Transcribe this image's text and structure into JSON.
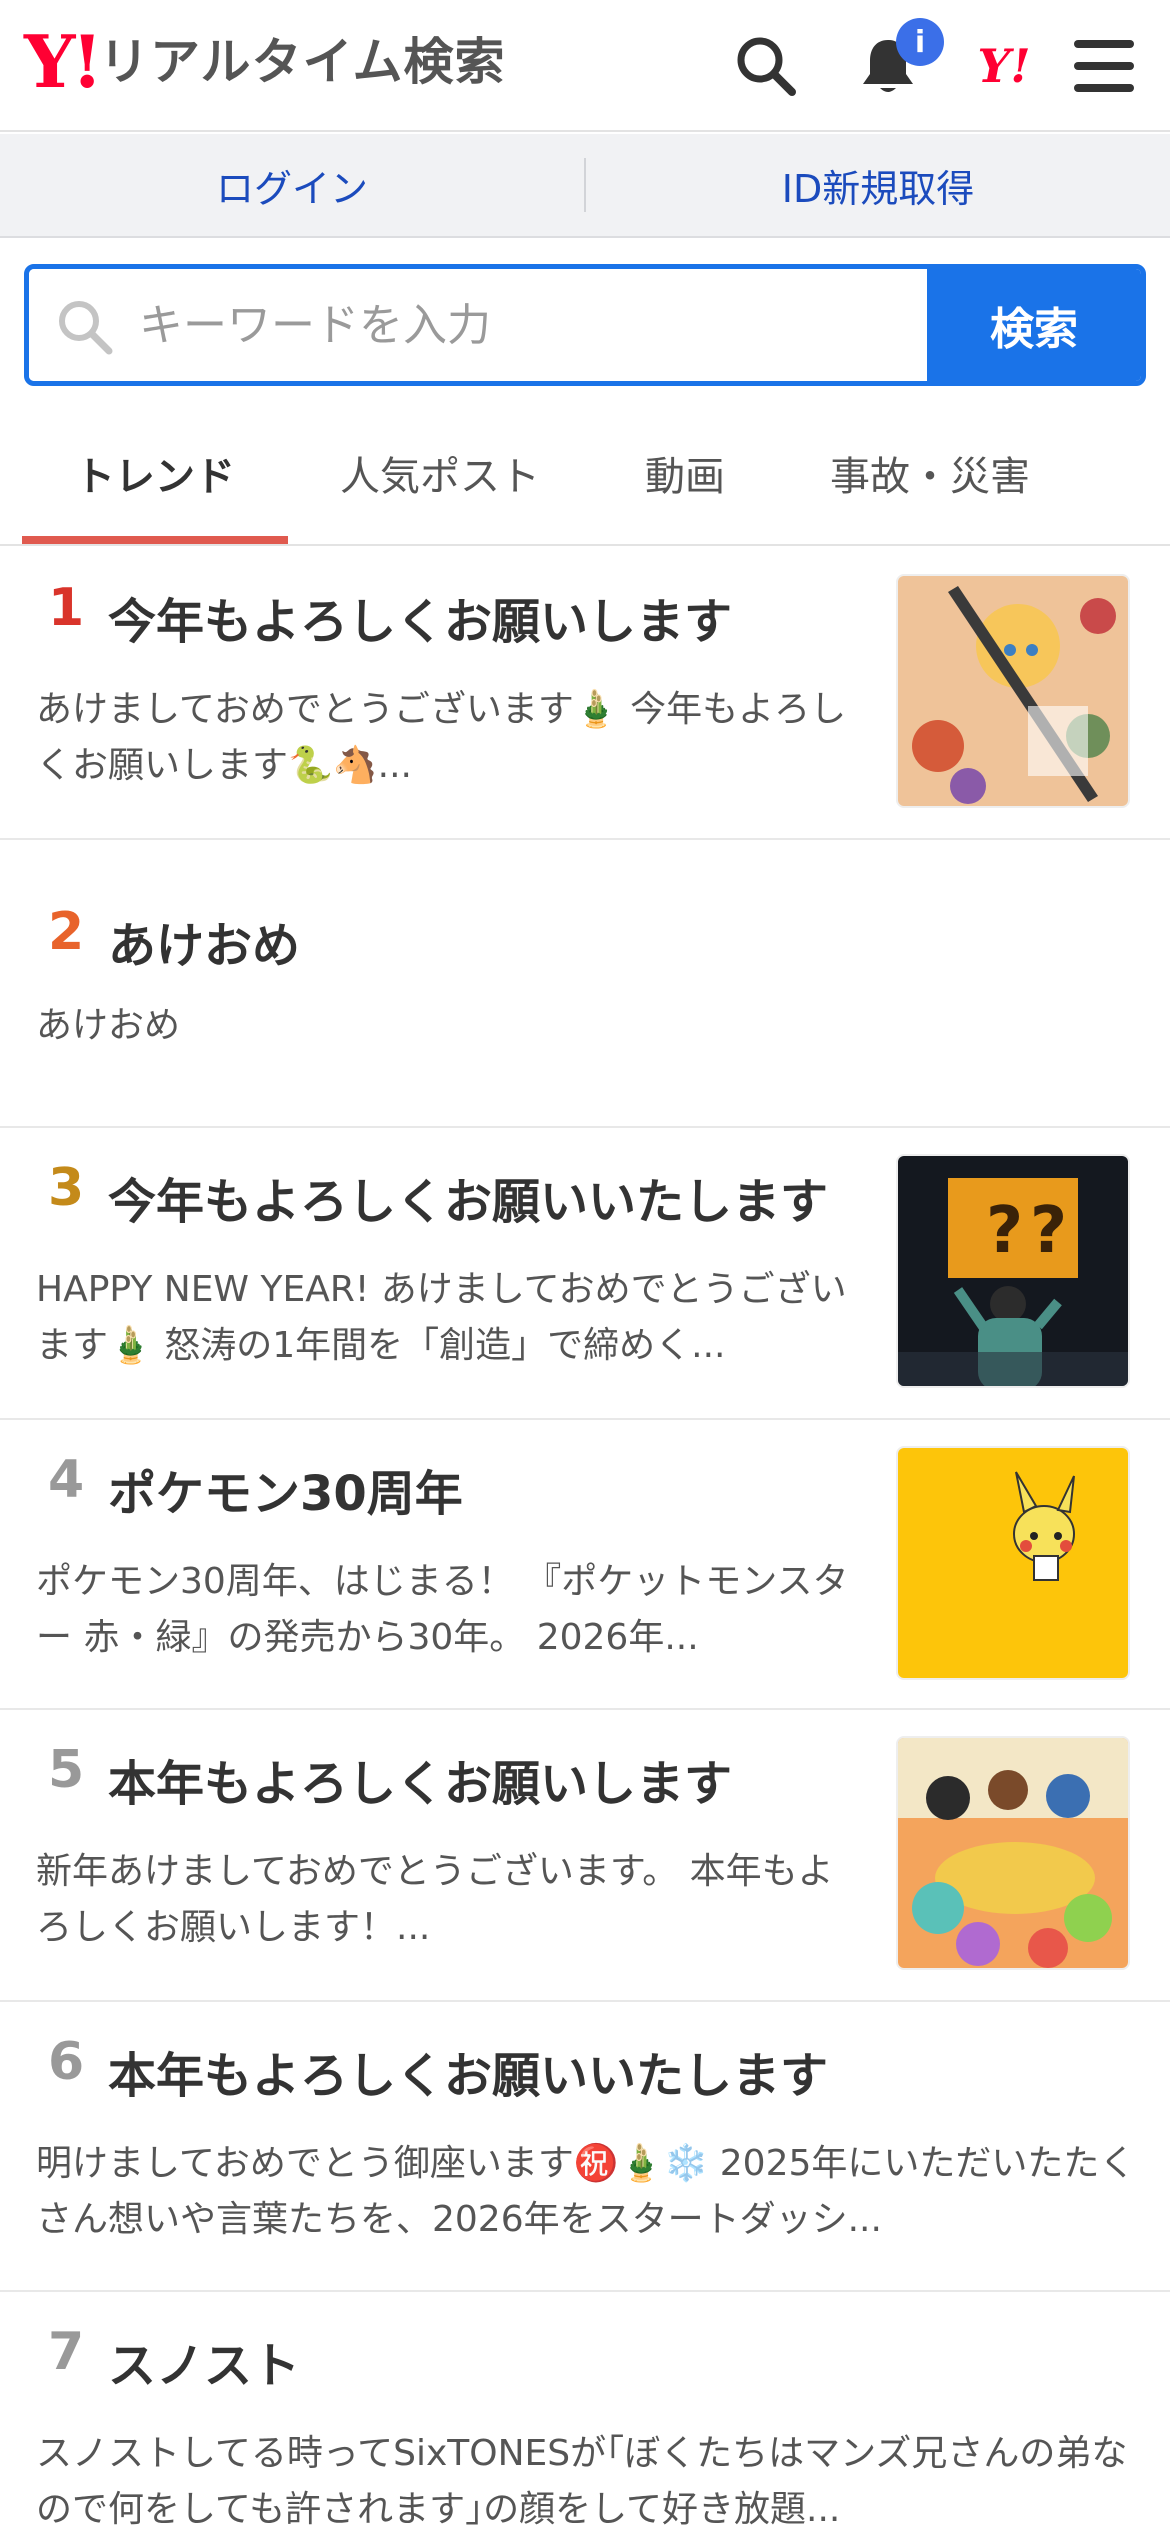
{
  "header": {
    "logo_mark": "Y!",
    "logo_text": "リアルタイム検索",
    "notification_badge": "i",
    "yjapan_mark": "Y!"
  },
  "auth": {
    "login": "ログイン",
    "signup": "ID新規取得"
  },
  "search": {
    "placeholder": "キーワードを入力",
    "button": "検索"
  },
  "tabs": [
    {
      "label": "トレンド",
      "active": true
    },
    {
      "label": "人気ポスト",
      "active": false
    },
    {
      "label": "動画",
      "active": false
    },
    {
      "label": "事故・災害",
      "active": false
    }
  ],
  "trends": [
    {
      "rank": "1",
      "title": "今年もよろしくお願いします",
      "desc": "あけましておめでとうございます🎍 今年もよろしくお願いします🐍🐴...",
      "rank_color": "#d9342b",
      "thumb": "anime-art"
    },
    {
      "rank": "2",
      "title": "あけおめ",
      "desc": "あけおめ",
      "rank_color": "#e8632b",
      "thumb": null
    },
    {
      "rank": "3",
      "title": "今年もよろしくお願いいたします",
      "desc": "HAPPY NEW YEAR! あけましておめでとうございます🎍 怒涛の1年間を「創造」で締めく...",
      "rank_color": "#c48a1a",
      "thumb": "question-block"
    },
    {
      "rank": "4",
      "title": "ポケモン30周年",
      "desc": "ポケモン30周年、はじまる！ 『ポケットモンスター 赤・緑』の発売から30年。 2026年...",
      "rank_color": "#999999",
      "thumb": "pikachu"
    },
    {
      "rank": "5",
      "title": "本年もよろしくお願いします",
      "desc": "新年あけましておめでとうございます。 本年もよろしくお願いします！...",
      "rank_color": "#999999",
      "thumb": "cartoon-group"
    },
    {
      "rank": "6",
      "title": "本年もよろしくお願いいたします",
      "desc": "明けましておめでとう御座います㊗️🎍❄️ 2025年にいただいたたくさん想いや言葉たちを、2026年をスタートダッシ...",
      "rank_color": "#999999",
      "thumb": null
    },
    {
      "rank": "7",
      "title": "スノスト",
      "desc": "スノストしてる時ってSixTONESが｢ぼくたちはマンズ兄さんの弟なので何をしても許されます｣の顔をして好き放題...",
      "rank_color": "#999999",
      "thumb": null
    }
  ],
  "colors": {
    "accent": "#1a73e8",
    "brand_red": "#ff0033",
    "tab_indicator": "#e05a4f",
    "link": "#1b4bbd"
  }
}
